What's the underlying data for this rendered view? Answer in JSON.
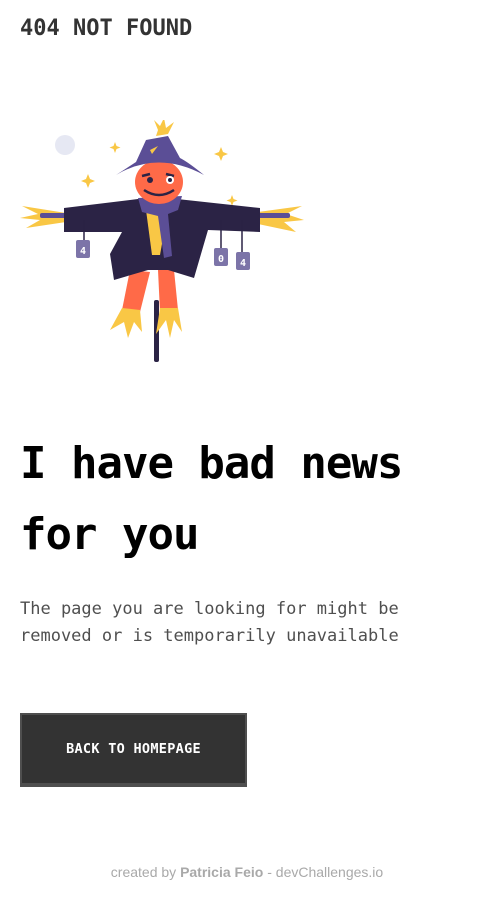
{
  "header": {
    "logo_text": "404 NOT FOUND"
  },
  "illustration": {
    "alt": "scarecrow-illustration",
    "sign_left": "4",
    "sign_mid": "0",
    "sign_right": "4",
    "colors": {
      "coat": "#2b2345",
      "hat": "#5b4e96",
      "face": "#ff6a48",
      "straw": "#f9c745",
      "moon": "#e6e8f3"
    }
  },
  "main": {
    "headline": "I have bad news for you",
    "message": "The page you are looking for might be removed or is temporarily unavailable",
    "cta_label": "BACK TO HOMEPAGE"
  },
  "footer": {
    "prefix": "created by",
    "author": "Patricia Feio",
    "separator": "-",
    "site": "devChallenges.io"
  }
}
